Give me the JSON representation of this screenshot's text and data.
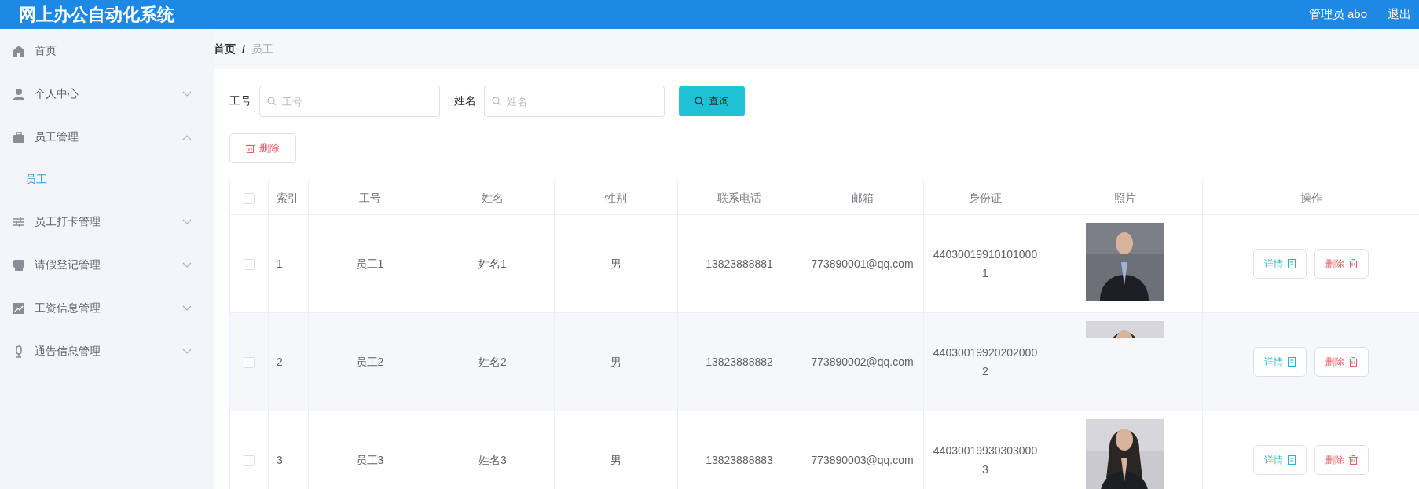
{
  "header": {
    "title": "网上办公自动化系统",
    "user": "管理员 abo",
    "logout": "退出"
  },
  "sidebar": {
    "items": [
      {
        "label": "首页"
      },
      {
        "label": "个人中心",
        "expanded": false
      },
      {
        "label": "员工管理",
        "expanded": true,
        "children": [
          {
            "label": "员工",
            "selected": true
          }
        ]
      },
      {
        "label": "员工打卡管理",
        "expanded": false
      },
      {
        "label": "请假登记管理",
        "expanded": false
      },
      {
        "label": "工资信息管理",
        "expanded": false
      },
      {
        "label": "通告信息管理",
        "expanded": false
      }
    ]
  },
  "breadcrumb": {
    "items": [
      "首页",
      "员工"
    ],
    "separator": "/"
  },
  "search": {
    "fields": [
      {
        "label": "工号",
        "placeholder": "工号"
      },
      {
        "label": "姓名",
        "placeholder": "姓名"
      }
    ],
    "button": "查询"
  },
  "delete_button": "删除",
  "table": {
    "select_all_checked": false,
    "columns": [
      "索引",
      "工号",
      "姓名",
      "性别",
      "联系电话",
      "邮箱",
      "身份证",
      "照片",
      "操作"
    ],
    "rows": [
      {
        "selected": false,
        "index": "1",
        "id": "员工1",
        "name": "姓名1",
        "gender": "男",
        "phone": "13823888881",
        "email": "773890001@qq.com",
        "id_card": "440300199101010001",
        "photo": {
          "kind": "picture",
          "partial": false
        },
        "actions": [
          "详情",
          "删除"
        ]
      },
      {
        "selected": false,
        "index": "2",
        "id": "员工2",
        "name": "姓名2",
        "gender": "男",
        "phone": "13823888882",
        "email": "773890002@qq.com",
        "id_card": "440300199202020002",
        "photo": {
          "kind": "picture",
          "partial": true
        },
        "actions": [
          "详情",
          "删除"
        ]
      },
      {
        "selected": false,
        "index": "3",
        "id": "员工3",
        "name": "姓名3",
        "gender": "男",
        "phone": "13823888883",
        "email": "773890003@qq.com",
        "id_card": "440300199303030003",
        "photo": {
          "kind": "picture",
          "partial": false
        },
        "actions": [
          "详情",
          "删除"
        ]
      }
    ]
  }
}
